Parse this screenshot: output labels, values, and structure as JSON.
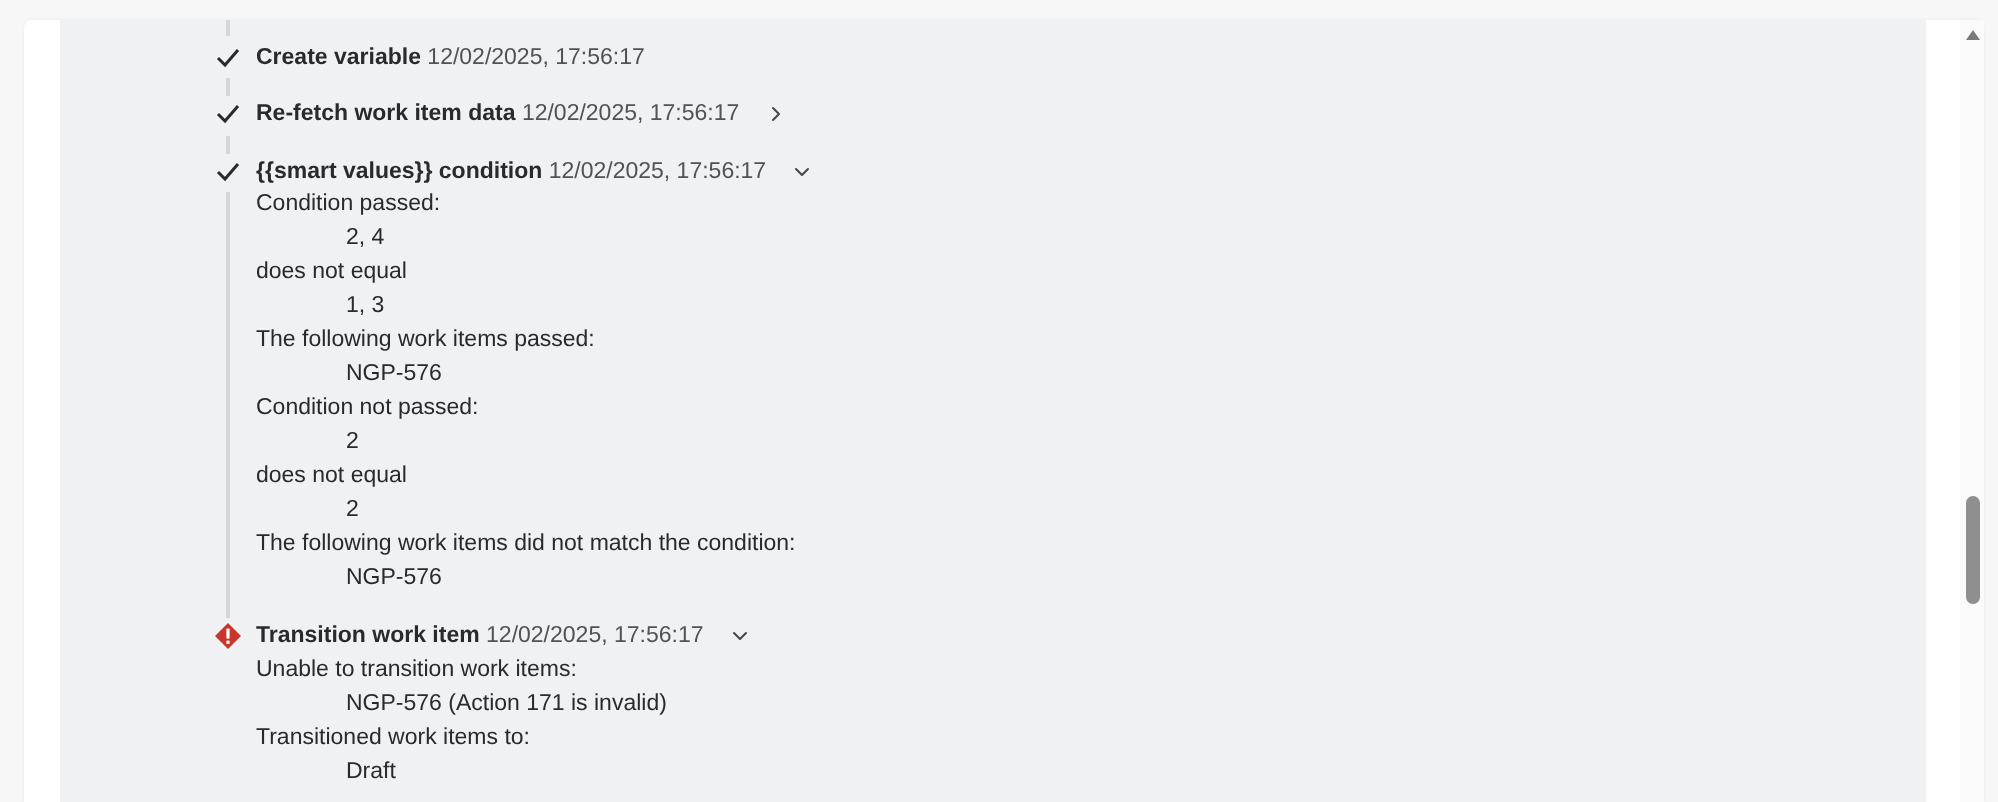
{
  "steps": [
    {
      "kind": "success",
      "title": "Create variable",
      "timestamp": "12/02/2025, 17:56:17"
    },
    {
      "kind": "success",
      "title": "Re-fetch work item data",
      "timestamp": "12/02/2025, 17:56:17",
      "expanded": false
    },
    {
      "kind": "success",
      "title": "{{smart values}} condition",
      "timestamp": "12/02/2025, 17:56:17",
      "expanded": true,
      "lines": [
        {
          "kind": "label",
          "text": "Condition passed:"
        },
        {
          "kind": "value",
          "text": "2, 4"
        },
        {
          "kind": "label",
          "text": "does not equal"
        },
        {
          "kind": "value",
          "text": "1, 3"
        },
        {
          "kind": "label",
          "text": "The following work items passed:"
        },
        {
          "kind": "value",
          "text": "NGP-576"
        },
        {
          "kind": "label",
          "text": "Condition not passed:"
        },
        {
          "kind": "value",
          "text": "2"
        },
        {
          "kind": "label",
          "text": "does not equal"
        },
        {
          "kind": "value",
          "text": "2"
        },
        {
          "kind": "label",
          "text": "The following work items did not match the condition:"
        },
        {
          "kind": "value",
          "text": "NGP-576"
        }
      ]
    },
    {
      "kind": "error",
      "title": "Transition work item",
      "timestamp": "12/02/2025, 17:56:17",
      "expanded": true,
      "lines": [
        {
          "kind": "label",
          "text": "Unable to transition work items:"
        },
        {
          "kind": "value",
          "text": "NGP-576 (Action 171 is invalid)"
        },
        {
          "kind": "label",
          "text": "Transitioned work items to:"
        },
        {
          "kind": "value",
          "text": "Draft"
        }
      ]
    }
  ]
}
